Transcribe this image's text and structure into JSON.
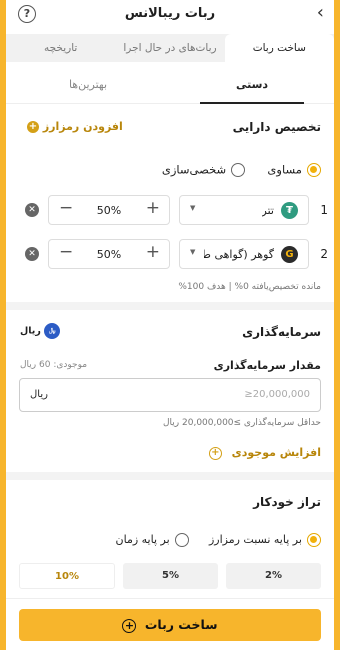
{
  "header": {
    "title": "ربات ریبالانس",
    "help_glyph": "?",
    "back_glyph": "‹"
  },
  "tabs": [
    {
      "label": "ساخت ربات",
      "active": true
    },
    {
      "label": "ربات‌های در حال اجرا",
      "active": false
    },
    {
      "label": "تاریخچه",
      "active": false
    }
  ],
  "subtabs": [
    {
      "label": "دستی",
      "active": true
    },
    {
      "label": "بهترین‌ها",
      "active": false
    }
  ],
  "allocation": {
    "title": "تخصیص دارایی",
    "add_asset_label": "افزودن رمزارز",
    "mode_options": [
      {
        "label": "مساوی",
        "selected": true
      },
      {
        "label": "شخصی‌سازی",
        "selected": false
      }
    ],
    "rows": [
      {
        "index": "1",
        "asset": "تتر",
        "icon": "tether-icon",
        "percent": "50%"
      },
      {
        "index": "2",
        "asset": "گوهر (گواهی ط",
        "icon": "gold-coin-icon",
        "percent": "50%"
      }
    ],
    "remaining_text": "مانده تخصیص‌یافته 0% | هدف 100%"
  },
  "investment": {
    "title": "سرمایه‌گذاری",
    "currency_label": "ریال",
    "amount_label": "مقدار سرمایه‌گذاری",
    "balance_text": "موجودی: 60 ریال",
    "input_placeholder": "≥20,000,000",
    "input_unit": "ریال",
    "min_text": "حداقل سرمایه‌گذاری ≥20,000,000 ریال",
    "increase_balance_label": "افزایش موجودی"
  },
  "auto_balance": {
    "title": "تراز خودکار",
    "options": [
      {
        "label": "بر پایه نسبت رمزارز",
        "selected": true
      },
      {
        "label": "بر پایه زمان",
        "selected": false
      }
    ],
    "thresholds": [
      {
        "label": "2%",
        "selected": false
      },
      {
        "label": "5%",
        "selected": false
      },
      {
        "label": "10%",
        "selected": true
      }
    ]
  },
  "cta": {
    "label": "ساخت ربات"
  },
  "colors": {
    "accent": "#f7b52c",
    "gold_text": "#b8860b",
    "tether": "#2f9b80"
  }
}
